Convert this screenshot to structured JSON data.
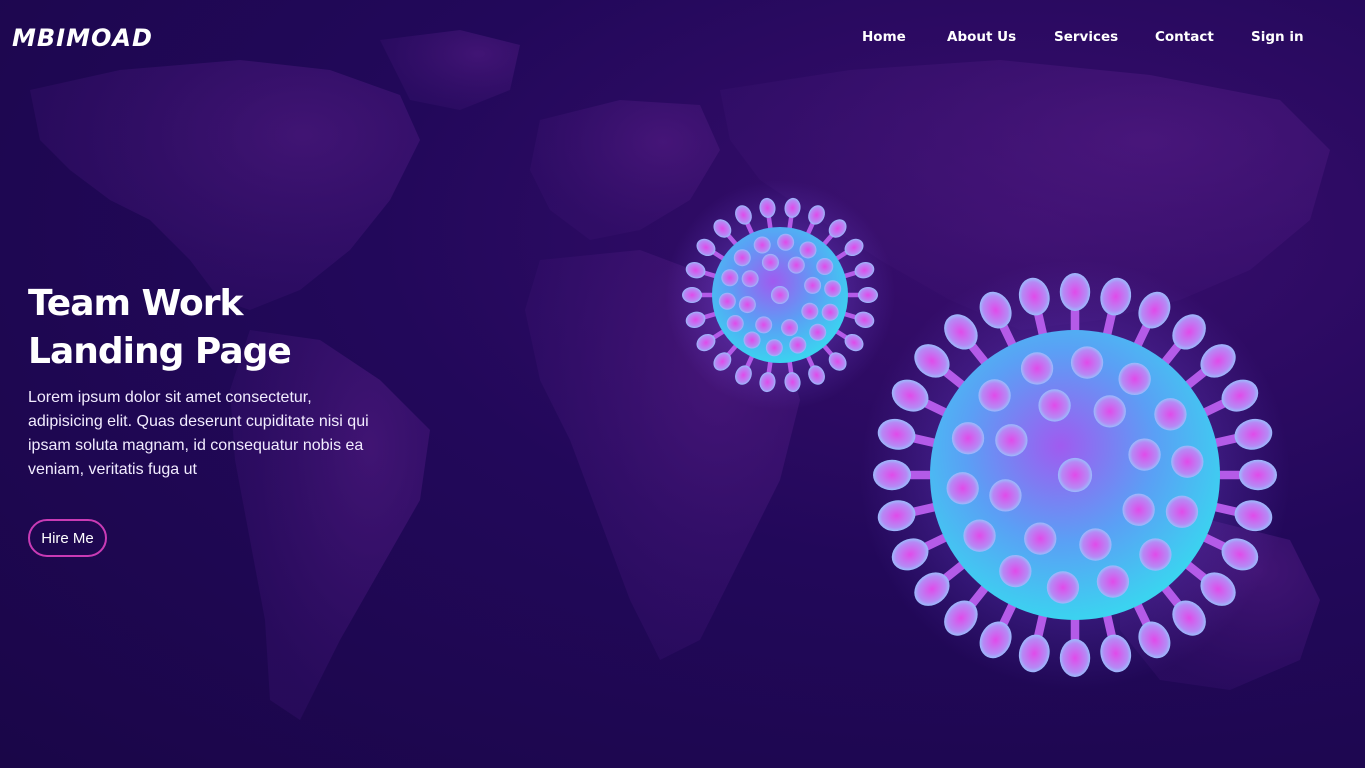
{
  "brand": {
    "logo_text": "MBIMOAD"
  },
  "nav": {
    "items": [
      {
        "label": "Home"
      },
      {
        "label": "About Us"
      },
      {
        "label": "Services"
      },
      {
        "label": "Contact"
      },
      {
        "label": "Sign in"
      }
    ]
  },
  "hero": {
    "title_line1": "Team Work",
    "title_line2": "Landing Page",
    "description": "Lorem ipsum dolor sit amet consectetur, adipisicing elit. Quas deserunt cupiditate nisi qui ipsam soluta magnam, id consequatur nobis ea veniam, veritatis fuga ut",
    "cta_label": "Hire Me"
  },
  "colors": {
    "background": "#1a0648",
    "accent_border": "#c93bb5",
    "virus_core": "#3bd3f0",
    "virus_spike": "#d24ee8"
  },
  "illustration": {
    "icon": "coronavirus-icon"
  }
}
